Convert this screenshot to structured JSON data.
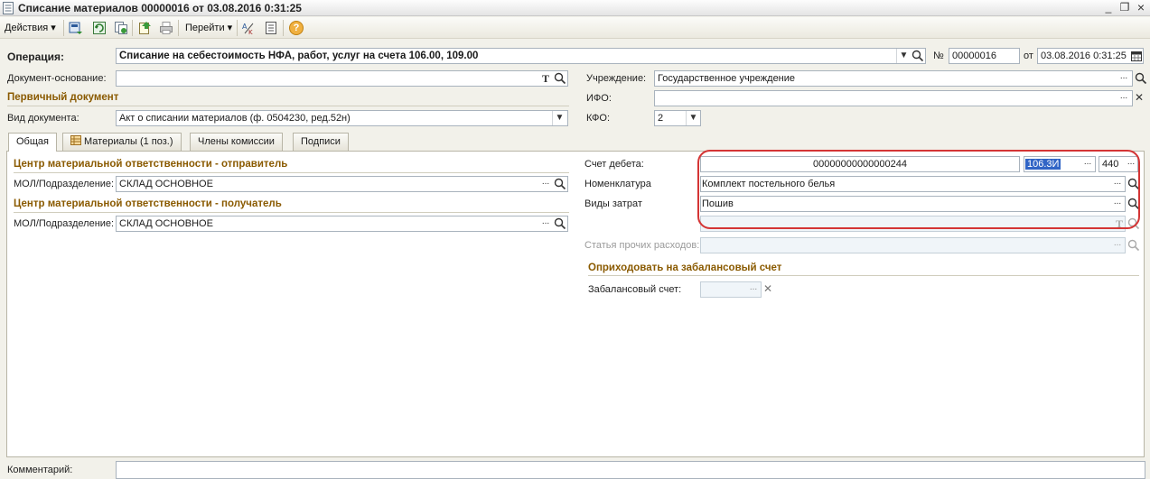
{
  "window": {
    "title": "Списание материалов 00000016 от 03.08.2016 0:31:25",
    "minimize_glyph": "_",
    "restore_glyph": "❐",
    "close_glyph": "×"
  },
  "toolbar": {
    "actions_label": "Действия",
    "goto_label": "Перейти",
    "dropdown_glyph": "▾",
    "help_glyph": "?"
  },
  "header": {
    "operation_label": "Операция:",
    "operation_value": "Списание на себестоимость НФА, работ, услуг на счета 106.00, 109.00",
    "number_label": "№",
    "number_value": "00000016",
    "date_label": "от",
    "date_value": "03.08.2016  0:31:25",
    "base_doc_label": "Документ-основание:",
    "base_doc_value": "",
    "institution_label": "Учреждение:",
    "institution_value": "Государственное учреждение",
    "primary_doc_heading": "Первичный документ",
    "ifo_label": "ИФО:",
    "ifo_value": "",
    "doc_type_label": "Вид документа:",
    "doc_type_value": "Акт о списании материалов (ф. 0504230, ред.52н)",
    "kfo_label": "КФО:",
    "kfo_value": "2"
  },
  "tabs": [
    {
      "label": "Общая"
    },
    {
      "label": "Материалы (1 поз.)"
    },
    {
      "label": "Члены комиссии"
    },
    {
      "label": "Подписи"
    }
  ],
  "general": {
    "sender_heading": "Центр материальной ответственности - отправитель",
    "sender_mol_label": "МОЛ/Подразделение:",
    "sender_mol_value": "СКЛАД ОСНОВНОЕ",
    "receiver_heading": "Центр материальной ответственности - получатель",
    "receiver_mol_label": "МОЛ/Подразделение:",
    "receiver_mol_value": "СКЛАД ОСНОВНОЕ",
    "debit_account_label": "Счет дебета:",
    "debit_account_code": "00000000000000244",
    "debit_account_value": "106.3И",
    "debit_account_kosgu": "440",
    "nomenclature_label": "Номенклатура",
    "nomenclature_value": "Комплект постельного белья",
    "cost_types_label": "Виды затрат",
    "cost_types_value": "Пошив",
    "extra_value": "",
    "other_expenses_label": "Статья прочих расходов:",
    "other_expenses_value": "",
    "offbalance_heading": "Оприходовать на забалансовый счет",
    "offbalance_label": "Забалансовый счет:",
    "offbalance_value": ""
  },
  "footer": {
    "comment_label": "Комментарий:",
    "comment_value": ""
  },
  "glyphs": {
    "ellipsis": "...",
    "clear": "✕",
    "dropdown": "▼",
    "text_edit": "T"
  },
  "colors": {
    "section_heading": "#8a5a00",
    "highlight_circle": "#d43535",
    "selection": "#3165c6"
  }
}
